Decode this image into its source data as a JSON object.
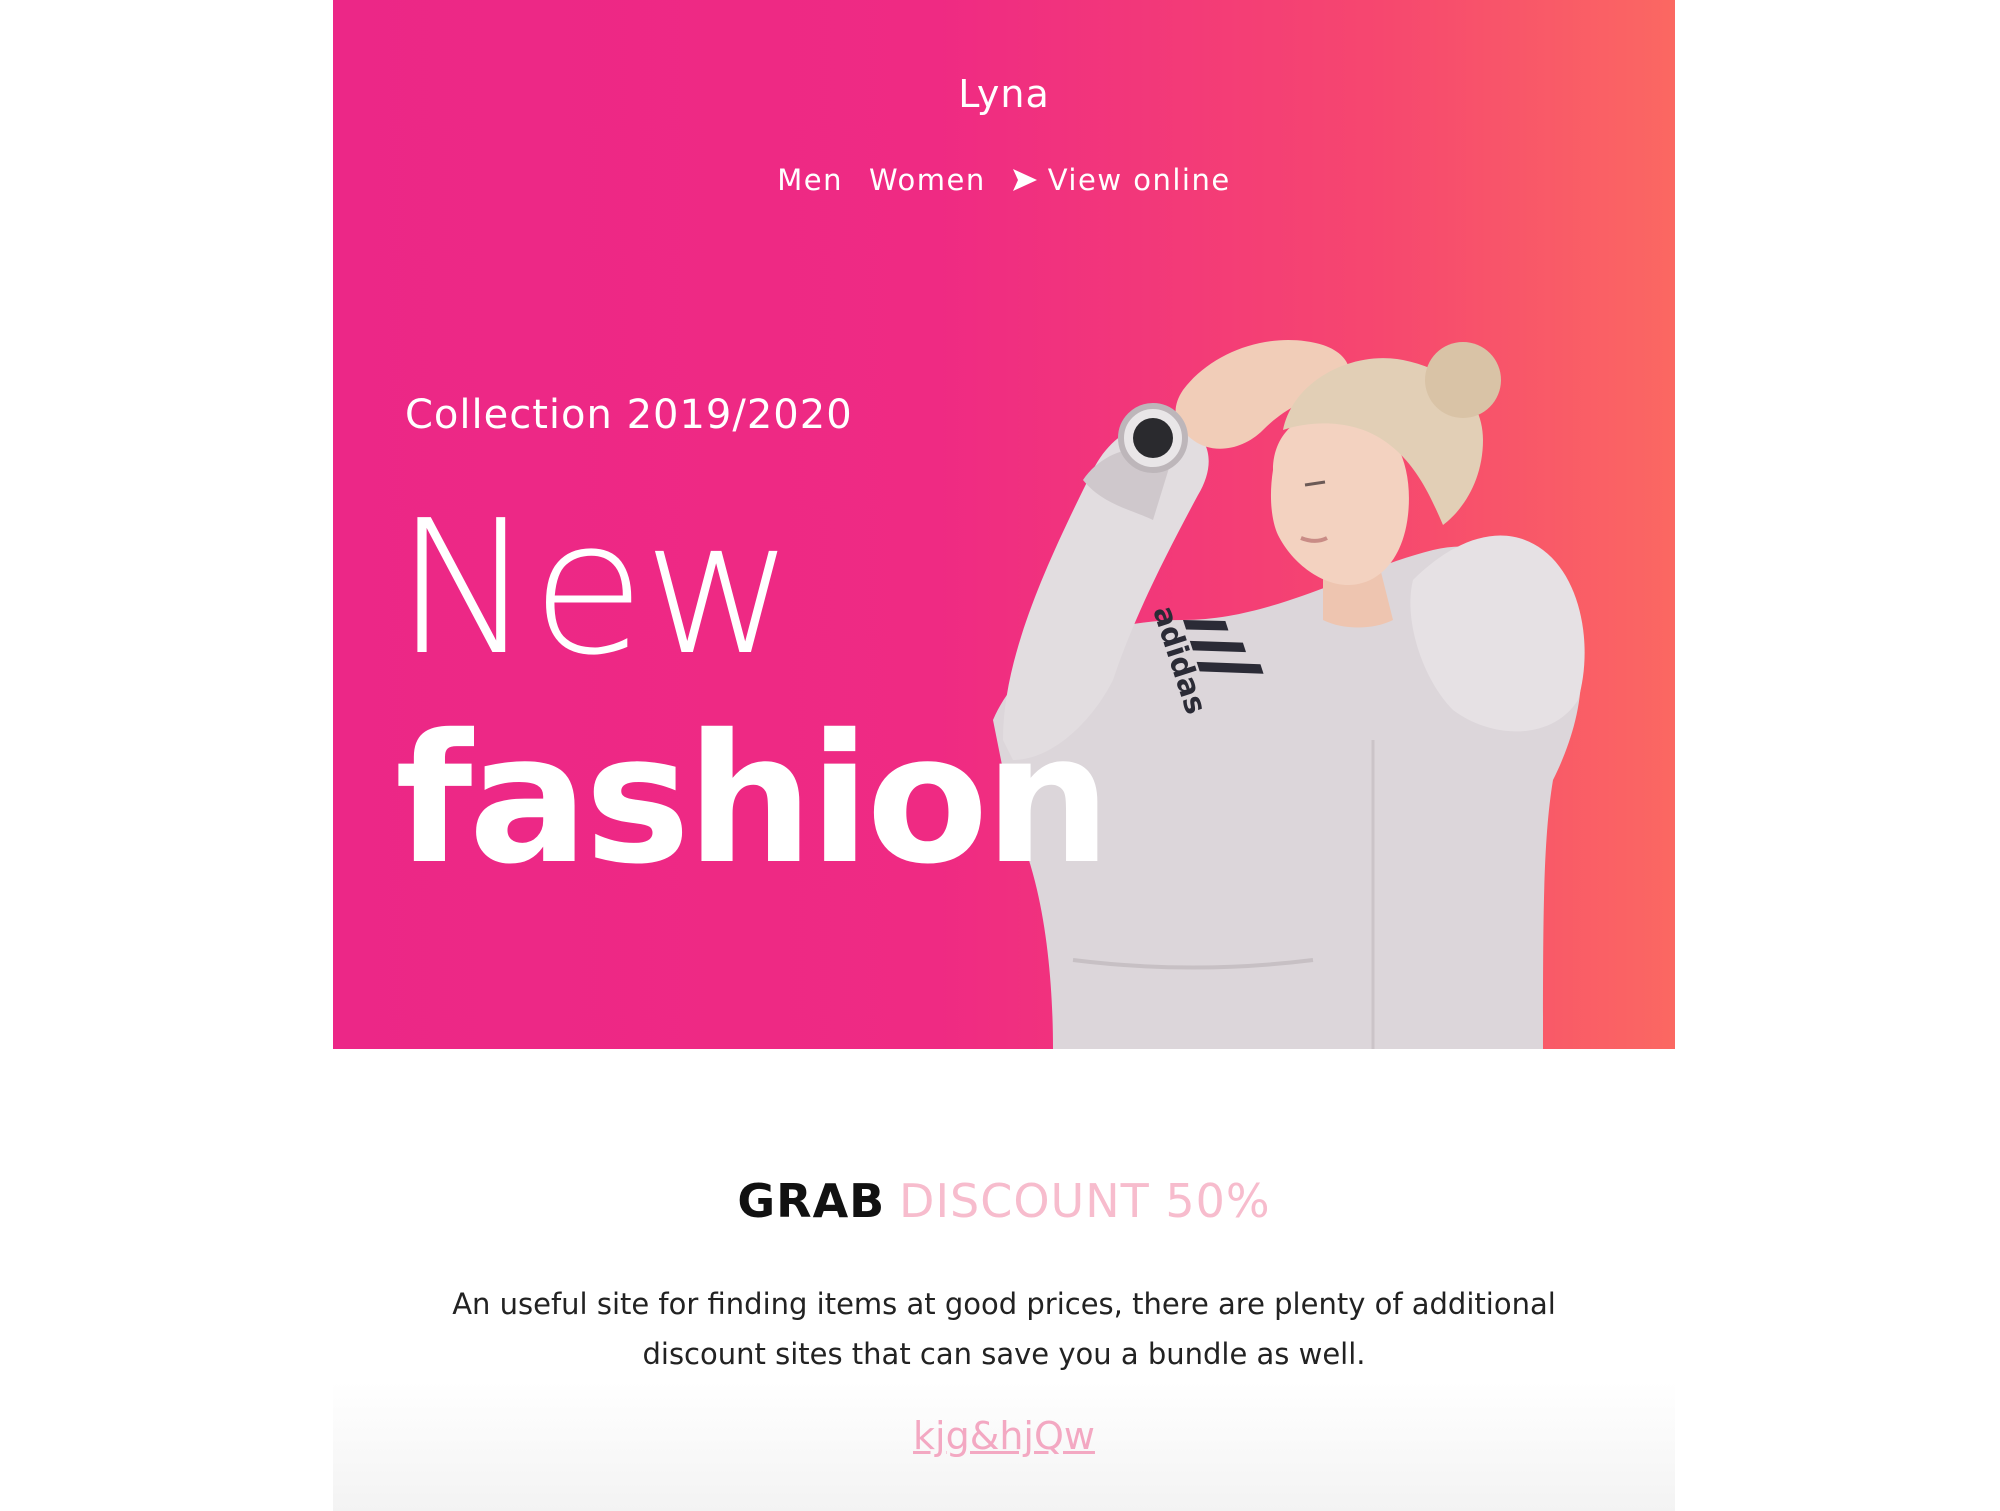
{
  "header": {
    "brand": "Lyna",
    "nav": {
      "men": "Men",
      "women": "Women",
      "view_online": "View online"
    }
  },
  "hero": {
    "collection": "Collection 2019/2020",
    "headline_line1": "New",
    "headline_line2": "fashion",
    "model_image": "woman-in-hoodie-photo",
    "hoodie_logo": "adidas",
    "gradient": [
      "#ec2787",
      "#fb6862"
    ]
  },
  "promo": {
    "title_strong": "GRAB",
    "title_accent": "DISCOUNT 50%",
    "description": "An useful site for finding items at good prices, there are plenty of additional discount sites that can save you a bundle as well.",
    "code": "kjg&hjQw",
    "accent_color": "#f7bccd"
  }
}
